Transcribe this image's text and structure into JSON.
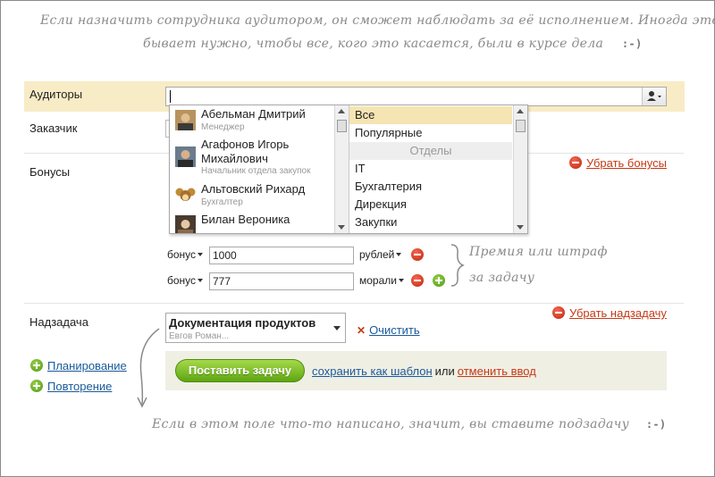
{
  "notes": {
    "top_line1": "Если назначить сотрудника аудитором, он сможет наблюдать за её исполнением. Иногда это",
    "top_line2": "бывает нужно, чтобы все, кого  это касается, были в курсе дела",
    "top_smiley": ":-)",
    "bonus_line1": "Премия или штраф",
    "bonus_line2": "за задачу",
    "bottom": "Если в этом поле что-то написано, значит, вы ставите подзадачу",
    "bottom_smiley": ":-)"
  },
  "auditors": {
    "label": "Аудиторы",
    "users": [
      {
        "name": "Абельман Дмитрий",
        "position": "Менеджер",
        "avatar_icon": "user-photo"
      },
      {
        "name": "Агафонов Игорь Михайлович",
        "position": "Начальник отдела закупок",
        "avatar_icon": "user-photo"
      },
      {
        "name": "Альтовский Рихард",
        "position": "Бухгалтер",
        "avatar_icon": "cheburashka-photo"
      },
      {
        "name": "Билан Вероника",
        "position": "",
        "avatar_icon": "user-photo"
      }
    ],
    "groups": [
      {
        "label": "Все",
        "selected": true
      },
      {
        "label": "Популярные"
      },
      {
        "label": "Отделы",
        "is_header": true
      },
      {
        "label": "IT"
      },
      {
        "label": "Бухгалтерия"
      },
      {
        "label": "Дирекция"
      },
      {
        "label": "Закупки"
      }
    ]
  },
  "customer": {
    "label": "Заказчик"
  },
  "bonuses": {
    "label": "Бонусы",
    "remove_link": "Убрать бонусы",
    "rows": [
      {
        "type": "бонус",
        "value": "1000",
        "unit": "рублей"
      },
      {
        "type": "бонус",
        "value": "777",
        "unit": "морали"
      }
    ]
  },
  "parent_task": {
    "label": "Надзадача",
    "title": "Документация продуктов",
    "subtitle": "Евгов Роман...",
    "clear_link": "Очистить",
    "remove_link": "Убрать надзадачу"
  },
  "side": {
    "planning": "Планирование",
    "repeat": "Повторение"
  },
  "submit": {
    "button": "Поставить задачу",
    "save_template": "сохранить как шаблон",
    "or": "или",
    "cancel": "отменить ввод"
  },
  "colors": {
    "auditor_band": "#f8ecc6",
    "link_red": "#c43a16",
    "link_blue": "#1a5a9a",
    "button_green": "#5fa511"
  }
}
